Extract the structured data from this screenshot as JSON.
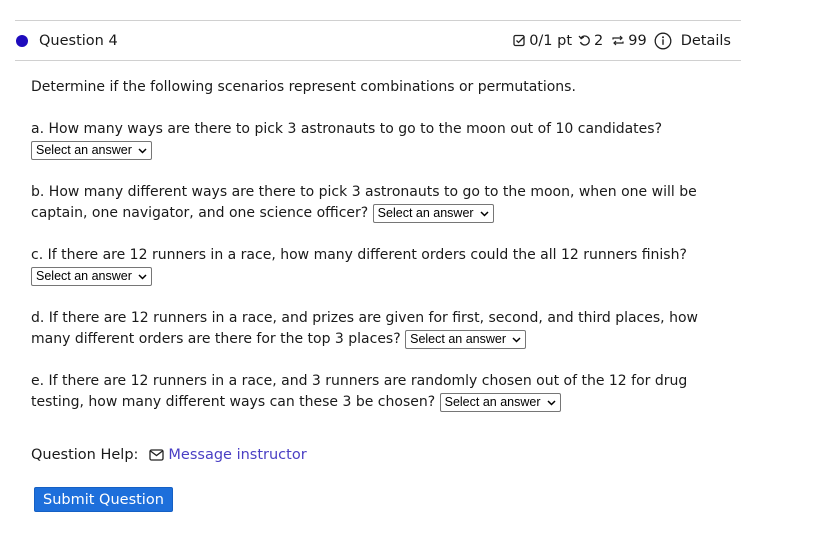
{
  "header": {
    "status_color": "#1e0bbd",
    "question_title": "Question 4",
    "score": "0/1 pt",
    "attempts": "2",
    "retries": "99",
    "details_label": "Details",
    "icons": [
      "checkbox-icon",
      "undo-icon",
      "retry-icon",
      "info-icon"
    ]
  },
  "body": {
    "intro": "Determine if the following scenarios represent combinations or permutations.",
    "parts": [
      {
        "text": "a. How many ways are there to pick 3 astronauts to go to the moon out of 10 candidates?",
        "select": "Select an answer"
      },
      {
        "text": "b. How many different ways are there to pick 3 astronauts to go to the moon, when one will be captain, one navigator, and one science officer?",
        "select": "Select an answer"
      },
      {
        "text": "c. If there are 12 runners in a race, how many different orders could the all 12 runners finish?",
        "select": "Select an answer"
      },
      {
        "text": "d. If there are 12 runners in a race, and prizes are given for first, second, and third places, how many different orders are there for the top 3 places?",
        "select": "Select an answer"
      },
      {
        "text": "e. If there are 12 runners in a race, and 3 runners are randomly chosen out of the 12 for drug testing, how many different ways can these 3 be chosen?",
        "select": "Select an answer"
      }
    ]
  },
  "help": {
    "label": "Question Help:",
    "link": "Message instructor"
  },
  "submit_label": "Submit Question"
}
